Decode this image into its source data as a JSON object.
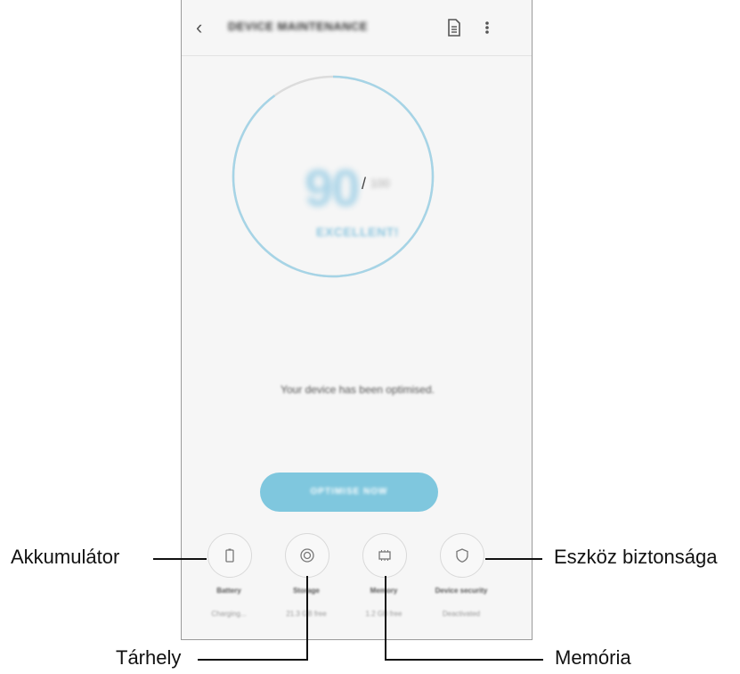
{
  "header": {
    "title": "DEVICE MAINTENANCE",
    "back_icon": "chevron-left-icon",
    "actions": [
      "document-icon",
      "more-vertical-icon"
    ]
  },
  "score": {
    "value": "90",
    "separator": "/",
    "max": "100",
    "status": "EXCELLENT!",
    "progress_fraction": 0.9
  },
  "message": "Your device has been optimised.",
  "optimise_button": "OPTIMISE NOW",
  "tiles": [
    {
      "label": "Battery",
      "value": "Charging...",
      "icon": "battery-icon"
    },
    {
      "label": "Storage",
      "value": "21.3 GB free",
      "icon": "storage-icon"
    },
    {
      "label": "Memory",
      "value": "1.2 GB free",
      "icon": "memory-icon"
    },
    {
      "label": "Device security",
      "value": "Deactivated",
      "icon": "shield-icon"
    }
  ],
  "callouts": {
    "battery": "Akkumulátor",
    "storage": "Tárhely",
    "memory": "Memória",
    "security": "Eszköz biztonsága"
  },
  "colors": {
    "accent": "#7fc7de",
    "gauge_ring": "#a6d4e6",
    "gauge_track": "#dcdcdc",
    "screen_bg": "#f6f6f6"
  }
}
